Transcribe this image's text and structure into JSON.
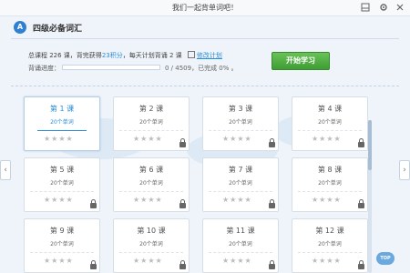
{
  "window": {
    "title": "我们一起背单词吧！",
    "icons": [
      "restore-icon",
      "settings-icon",
      "close-icon"
    ]
  },
  "book": {
    "icon_letter": "A",
    "title": "四级必备词汇"
  },
  "info": {
    "prefix": "总课程 226 课，背完获得",
    "points": "23积分",
    "middle": "，每天计划背诵 2 课",
    "edit_label": "修改计划"
  },
  "progress": {
    "label": "背诵进度：",
    "value": 0,
    "total": 4509,
    "text": "0 / 4509，已完成 0% 。"
  },
  "start_button": "开始学习",
  "lessons": [
    {
      "label": "第 1 课",
      "count": "20个单词",
      "stars": "★★★★",
      "locked": false,
      "active": true
    },
    {
      "label": "第 2 课",
      "count": "20个单词",
      "stars": "★★★★",
      "locked": true,
      "active": false
    },
    {
      "label": "第 3 课",
      "count": "20个单词",
      "stars": "★★★★",
      "locked": true,
      "active": false
    },
    {
      "label": "第 4 课",
      "count": "20个单词",
      "stars": "★★★★",
      "locked": true,
      "active": false
    },
    {
      "label": "第 5 课",
      "count": "20个单词",
      "stars": "★★★★",
      "locked": true,
      "active": false
    },
    {
      "label": "第 6 课",
      "count": "20个单词",
      "stars": "★★★★",
      "locked": true,
      "active": false
    },
    {
      "label": "第 7 课",
      "count": "20个单词",
      "stars": "★★★★",
      "locked": true,
      "active": false
    },
    {
      "label": "第 8 课",
      "count": "20个单词",
      "stars": "★★★★",
      "locked": true,
      "active": false
    },
    {
      "label": "第 9 课",
      "count": "20个单词",
      "stars": "★★★★",
      "locked": true,
      "active": false
    },
    {
      "label": "第 10 课",
      "count": "20个单词",
      "stars": "★★★★",
      "locked": true,
      "active": false
    },
    {
      "label": "第 11 课",
      "count": "20个单词",
      "stars": "★★★★",
      "locked": true,
      "active": false
    },
    {
      "label": "第 12 课",
      "count": "20个单词",
      "stars": "★★★★",
      "locked": true,
      "active": false
    }
  ],
  "nav": {
    "prev": "‹",
    "next": "›",
    "top_label": "TOP"
  }
}
